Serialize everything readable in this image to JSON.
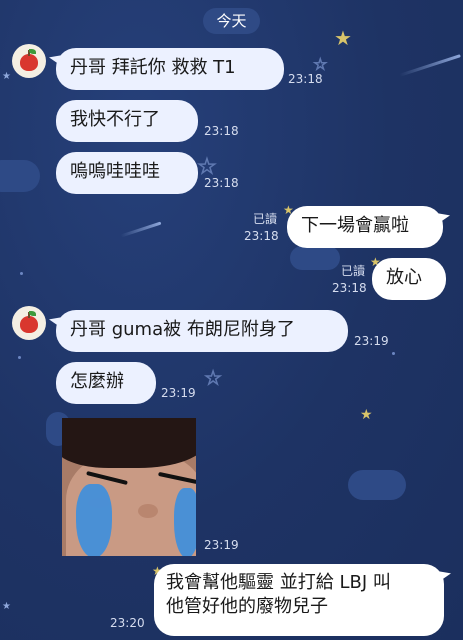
{
  "conversation": {
    "date_label": "今天",
    "messages": [
      {
        "text": "丹哥 拜託你 救救 T1",
        "time": "23:18"
      },
      {
        "text": "我快不行了",
        "time": "23:18"
      },
      {
        "text": "嗚嗚哇哇哇",
        "time": "23:18"
      },
      {
        "text": "下一場會贏啦",
        "time": "23:18",
        "read": "已讀"
      },
      {
        "text": "放心",
        "time": "23:18",
        "read": "已讀"
      },
      {
        "text": "丹哥 guma被 布朗尼附身了",
        "time": "23:19"
      },
      {
        "text": "怎麼辦",
        "time": "23:19"
      },
      {
        "time": "23:19"
      },
      {
        "line1": "我會幫他驅靈 並打給 LBJ 叫",
        "line2": "他管好他的廢物兒子",
        "time": "23:20"
      }
    ]
  },
  "icons": {
    "contact_avatar": "apple-avatar-icon",
    "sticker": "crying-face-sticker",
    "background_deco": [
      "star-icon",
      "cloud-shape",
      "shooting-star"
    ]
  },
  "colors": {
    "background": "#1e3364",
    "incoming_bubble": "#ecf1ff",
    "outgoing_bubble": "#ffffff",
    "star": "#d8c46a",
    "date_pill": "#2f4a85"
  }
}
